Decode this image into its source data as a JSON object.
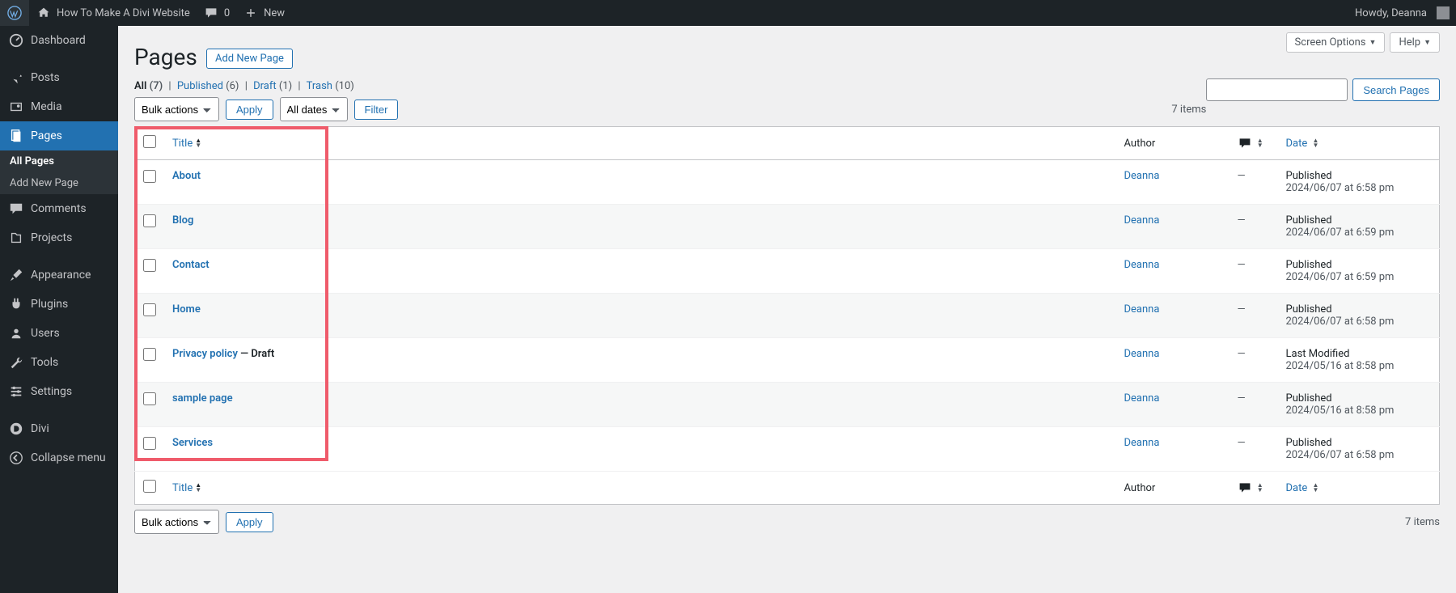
{
  "adminbar": {
    "site_title": "How To Make A Divi Website",
    "comments_count": "0",
    "new_label": "New",
    "howdy": "Howdy, Deanna"
  },
  "sidebar": {
    "items": [
      {
        "id": "dashboard",
        "label": "Dashboard"
      },
      {
        "id": "posts",
        "label": "Posts"
      },
      {
        "id": "media",
        "label": "Media"
      },
      {
        "id": "pages",
        "label": "Pages"
      },
      {
        "id": "comments",
        "label": "Comments"
      },
      {
        "id": "projects",
        "label": "Projects"
      },
      {
        "id": "appearance",
        "label": "Appearance"
      },
      {
        "id": "plugins",
        "label": "Plugins"
      },
      {
        "id": "users",
        "label": "Users"
      },
      {
        "id": "tools",
        "label": "Tools"
      },
      {
        "id": "settings",
        "label": "Settings"
      },
      {
        "id": "divi",
        "label": "Divi"
      },
      {
        "id": "collapse",
        "label": "Collapse menu"
      }
    ],
    "pages_sub": [
      {
        "label": "All Pages"
      },
      {
        "label": "Add New Page"
      }
    ]
  },
  "header": {
    "screen_options": "Screen Options",
    "help": "Help",
    "heading": "Pages",
    "add_new": "Add New Page"
  },
  "filters": {
    "all": "All",
    "all_count": "(7)",
    "published": "Published",
    "published_count": "(6)",
    "draft": "Draft",
    "draft_count": "(1)",
    "trash": "Trash",
    "trash_count": "(10)"
  },
  "search": {
    "button": "Search Pages",
    "value": ""
  },
  "tablenav": {
    "bulk": "Bulk actions",
    "apply": "Apply",
    "dates": "All dates",
    "filter": "Filter",
    "items": "7 items"
  },
  "columns": {
    "title": "Title",
    "author": "Author",
    "date": "Date"
  },
  "rows": [
    {
      "title": "About",
      "author": "Deanna",
      "comments": "—",
      "status": "Published",
      "stamp": "2024/06/07 at 6:58 pm",
      "state": ""
    },
    {
      "title": "Blog",
      "author": "Deanna",
      "comments": "—",
      "status": "Published",
      "stamp": "2024/06/07 at 6:59 pm",
      "state": ""
    },
    {
      "title": "Contact",
      "author": "Deanna",
      "comments": "—",
      "status": "Published",
      "stamp": "2024/06/07 at 6:59 pm",
      "state": ""
    },
    {
      "title": "Home",
      "author": "Deanna",
      "comments": "—",
      "status": "Published",
      "stamp": "2024/06/07 at 6:58 pm",
      "state": ""
    },
    {
      "title": "Privacy policy",
      "author": "Deanna",
      "comments": "—",
      "status": "Last Modified",
      "stamp": "2024/05/16 at 8:58 pm",
      "state": " — Draft"
    },
    {
      "title": "sample page",
      "author": "Deanna",
      "comments": "—",
      "status": "Published",
      "stamp": "2024/05/16 at 8:58 pm",
      "state": ""
    },
    {
      "title": "Services",
      "author": "Deanna",
      "comments": "—",
      "status": "Published",
      "stamp": "2024/06/07 at 6:58 pm",
      "state": ""
    }
  ]
}
